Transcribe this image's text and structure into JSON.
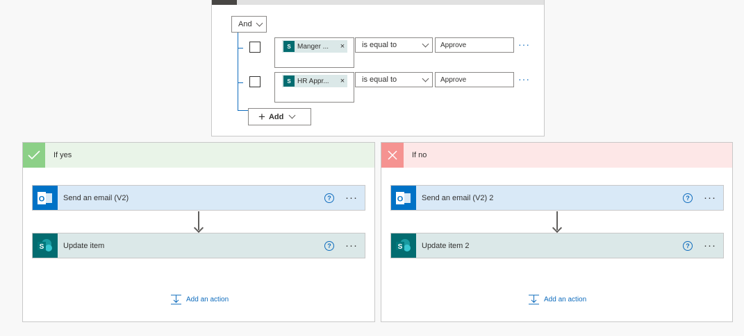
{
  "condition": {
    "group_operator": "And",
    "rows": [
      {
        "field_token": "Manger ...",
        "operator": "is equal to",
        "value": "Approve",
        "token_icon": "sharepoint-icon"
      },
      {
        "field_token": "HR Appr...",
        "operator": "is equal to",
        "value": "Approve",
        "token_icon": "sharepoint-icon"
      }
    ],
    "token_remove": "×",
    "row_more": "···",
    "add_button": {
      "label": "Add",
      "plus": "+"
    }
  },
  "branches": {
    "yes": {
      "title": "If yes",
      "color": "#e9f4e8",
      "icon_color": "#8cd087",
      "actions": [
        {
          "name": "Send an email (V2)",
          "icon": "outlook-icon",
          "bg": "#d9e9f7"
        },
        {
          "name": "Update item",
          "icon": "sharepoint-icon",
          "bg": "#dbe8e8"
        }
      ],
      "add_action": "Add an action"
    },
    "no": {
      "title": "If no",
      "color": "#fde7e7",
      "icon_color": "#f59391",
      "actions": [
        {
          "name": "Send an email (V2) 2",
          "icon": "outlook-icon",
          "bg": "#d9e9f7"
        },
        {
          "name": "Update item 2",
          "icon": "sharepoint-icon",
          "bg": "#dbe8e8"
        }
      ],
      "add_action": "Add an action"
    }
  },
  "common": {
    "help": "?",
    "more": "···",
    "outlook_letter": "O",
    "sharepoint_letter": "S"
  }
}
